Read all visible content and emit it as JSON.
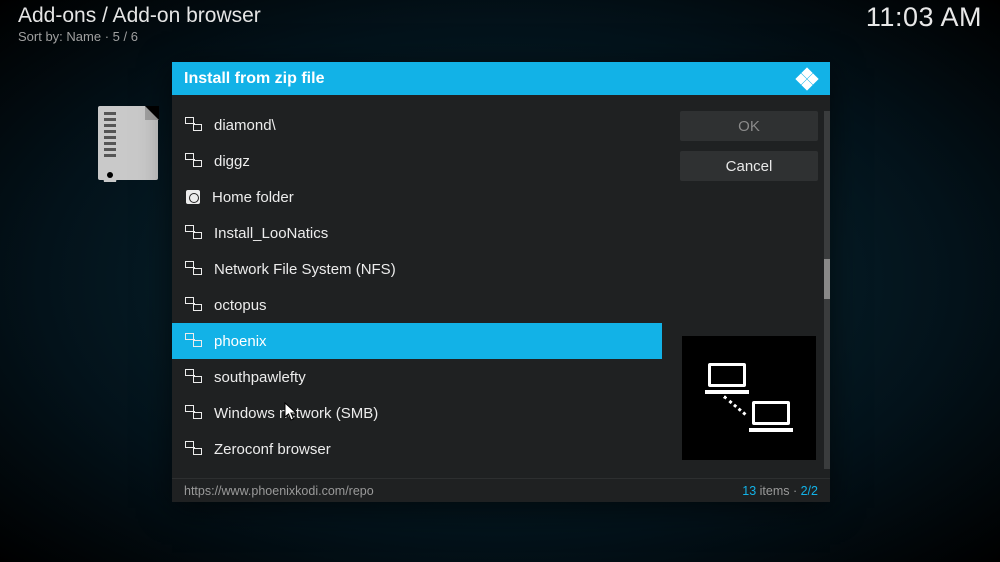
{
  "header": {
    "breadcrumb": "Add-ons / Add-on browser",
    "sort_prefix": "Sort by: ",
    "sort_value": "Name",
    "sort_sep": "  ·  5 / 6"
  },
  "clock": "11:03 AM",
  "dialog": {
    "title": "Install from zip file",
    "buttons": {
      "ok": "OK",
      "cancel": "Cancel"
    },
    "files": [
      {
        "label": "diamond\\",
        "icon": "net"
      },
      {
        "label": "diggz",
        "icon": "net"
      },
      {
        "label": "Home folder",
        "icon": "home"
      },
      {
        "label": "Install_LooNatics",
        "icon": "net"
      },
      {
        "label": "Network File System (NFS)",
        "icon": "net"
      },
      {
        "label": "octopus",
        "icon": "net"
      },
      {
        "label": "phoenix",
        "icon": "net",
        "selected": true
      },
      {
        "label": "southpawlefty",
        "icon": "net"
      },
      {
        "label": "Windows network (SMB)",
        "icon": "net"
      },
      {
        "label": "Zeroconf browser",
        "icon": "net"
      }
    ],
    "footer": {
      "url": "https://www.phoenixkodi.com/repo",
      "items_count": "13",
      "items_word": " items · ",
      "page": "2/2"
    }
  }
}
